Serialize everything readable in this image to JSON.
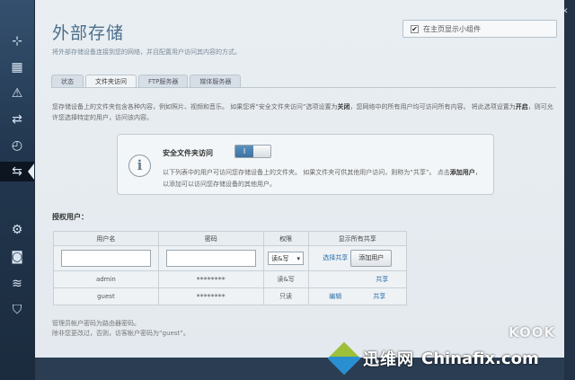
{
  "page": {
    "title": "外部存储",
    "subtitle": "将外部存储设备连接到您的网络，并且配置用户访问其内容的方式。",
    "home_widget_label": "在主页显示小组件",
    "home_widget_checked": "✔"
  },
  "tabs": [
    {
      "label": "状态"
    },
    {
      "label": "文件夹访问"
    },
    {
      "label": "FTP服务器"
    },
    {
      "label": "媒体服务器"
    }
  ],
  "description": {
    "part1": "您存储设备上的文件夹包含各种内容，例如照片、视频和音乐。 如果您将“安全文件夹访问”选项设置为",
    "bold1": "关闭",
    "part2": "，您网络中的所有用户均可访问所有内容。 将此选项设置为",
    "bold2": "开启",
    "part3": "，则可允许您选择特定的用户，访问该内容。"
  },
  "secure_access": {
    "title": "安全文件夹访问",
    "toggle_on_label": "I",
    "text1": "以下列表中的用户可访问您存储设备上的文件夹。 如果文件夹可供其他用户访问，则称为“共享”。 点击",
    "bold": "添加用户",
    "text2": "，以添加可以访问您存储设备的其他用户。"
  },
  "authorized_users": {
    "label": "授权用户：",
    "headers": {
      "username": "用户名",
      "password": "密码",
      "permission": "权限",
      "show_shares": "显示所有共享"
    },
    "input_row": {
      "permission_value": "读&写",
      "select_shares": "选择共享",
      "add_user": "添加用户"
    },
    "rows": [
      {
        "username": "admin",
        "password": "********",
        "permission": "读&写",
        "edit": "",
        "share": "共享"
      },
      {
        "username": "guest",
        "password": "********",
        "permission": "只读",
        "edit": "编辑",
        "share": "共享"
      }
    ]
  },
  "footnote": {
    "line1": "管理员帐户密码为路由器密码。",
    "line2": "除非您更改过，否则，访客帐户密码为“guest”。"
  },
  "watermark": {
    "cn": "迅维网",
    "en": "Chinafix.com",
    "kook": "KOOK"
  }
}
